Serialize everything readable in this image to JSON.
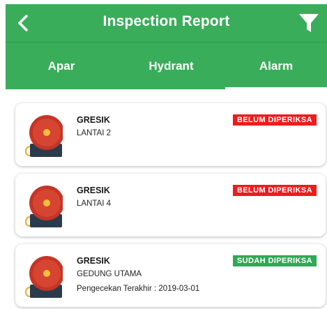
{
  "header": {
    "title": "Inspection Report",
    "back_icon": "chevron-left-icon",
    "filter_icon": "filter-funnel-icon"
  },
  "tabs": [
    {
      "label": "Apar",
      "active": false
    },
    {
      "label": "Hydrant",
      "active": false
    },
    {
      "label": "Alarm",
      "active": true
    }
  ],
  "items": [
    {
      "site": "GRESIK",
      "location": "LANTAI 2",
      "status": "BELUM DIPERIKSA",
      "status_color": "#ee1c1c",
      "last_check": ""
    },
    {
      "site": "GRESIK",
      "location": "LANTAI 4",
      "status": "BELUM DIPERIKSA",
      "status_color": "#ee1c1c",
      "last_check": ""
    },
    {
      "site": "GRESIK",
      "location": "GEDUNG UTAMA",
      "status": "SUDAH DIPERIKSA",
      "status_color": "#2fa956",
      "last_check": "Pengecekan Terakhir : 2019-03-01"
    }
  ],
  "colors": {
    "primary": "#3aad5a",
    "unchecked": "#ee1c1c",
    "checked": "#2fa956"
  }
}
